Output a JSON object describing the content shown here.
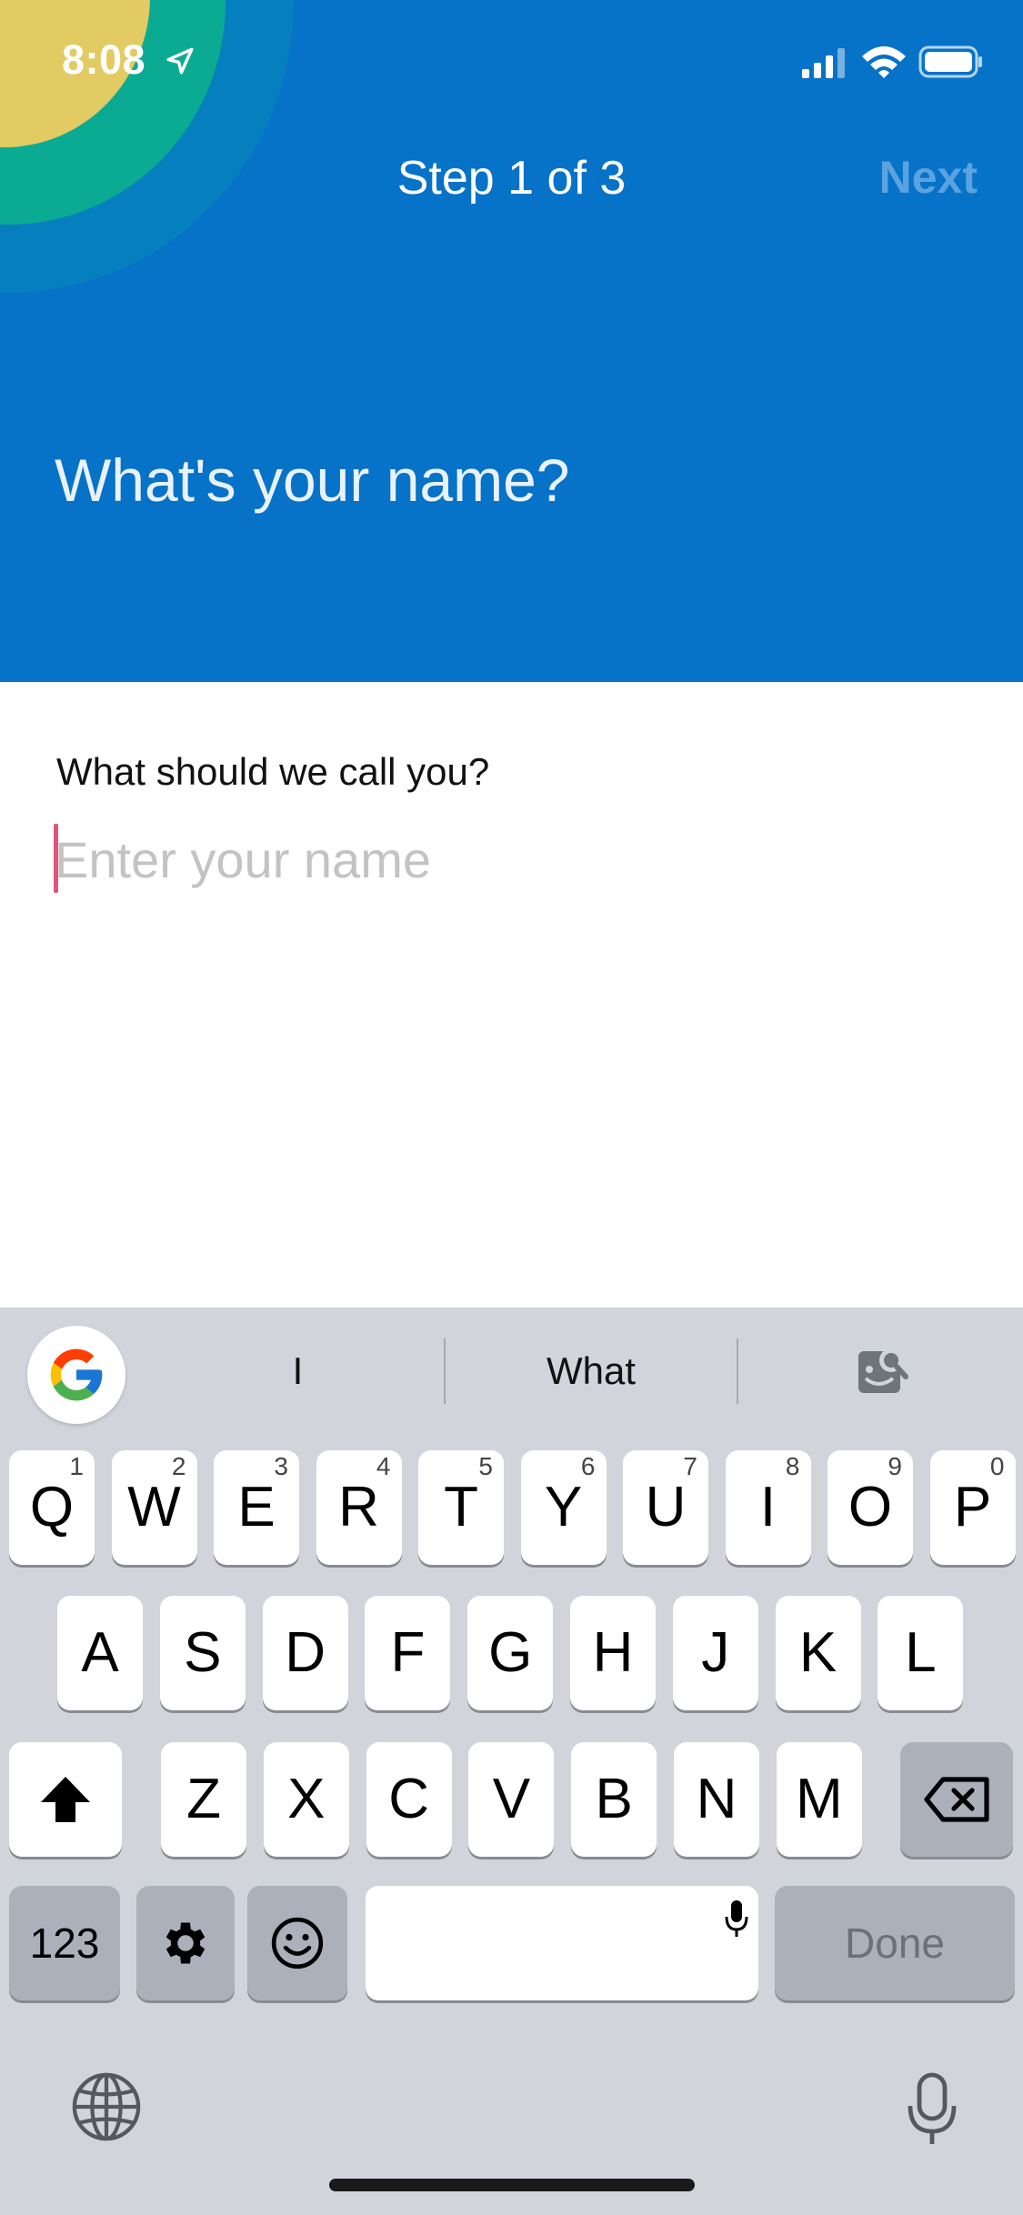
{
  "status_bar": {
    "time": "8:08",
    "icons": [
      "location-arrow-icon",
      "signal-icon",
      "wifi-icon",
      "battery-icon"
    ]
  },
  "header": {
    "step_title": "Step 1 of 3",
    "next_label": "Next",
    "heading": "What's your name?"
  },
  "form": {
    "label": "What should we call you?",
    "name_placeholder": "Enter your name",
    "name_value": ""
  },
  "keyboard": {
    "suggestions": [
      "I",
      "What"
    ],
    "row1": [
      {
        "letter": "Q",
        "hint": "1"
      },
      {
        "letter": "W",
        "hint": "2"
      },
      {
        "letter": "E",
        "hint": "3"
      },
      {
        "letter": "R",
        "hint": "4"
      },
      {
        "letter": "T",
        "hint": "5"
      },
      {
        "letter": "Y",
        "hint": "6"
      },
      {
        "letter": "U",
        "hint": "7"
      },
      {
        "letter": "I",
        "hint": "8"
      },
      {
        "letter": "O",
        "hint": "9"
      },
      {
        "letter": "P",
        "hint": "0"
      }
    ],
    "row2": [
      "A",
      "S",
      "D",
      "F",
      "G",
      "H",
      "J",
      "K",
      "L"
    ],
    "row3": [
      "Z",
      "X",
      "C",
      "V",
      "B",
      "N",
      "M"
    ],
    "numbers_label": "123",
    "done_label": "Done"
  },
  "colors": {
    "header_blue": "#0672c8",
    "next_disabled": "#5aa3e0",
    "caret": "#e2547a",
    "keyboard_bg": "#d2d4dc"
  }
}
